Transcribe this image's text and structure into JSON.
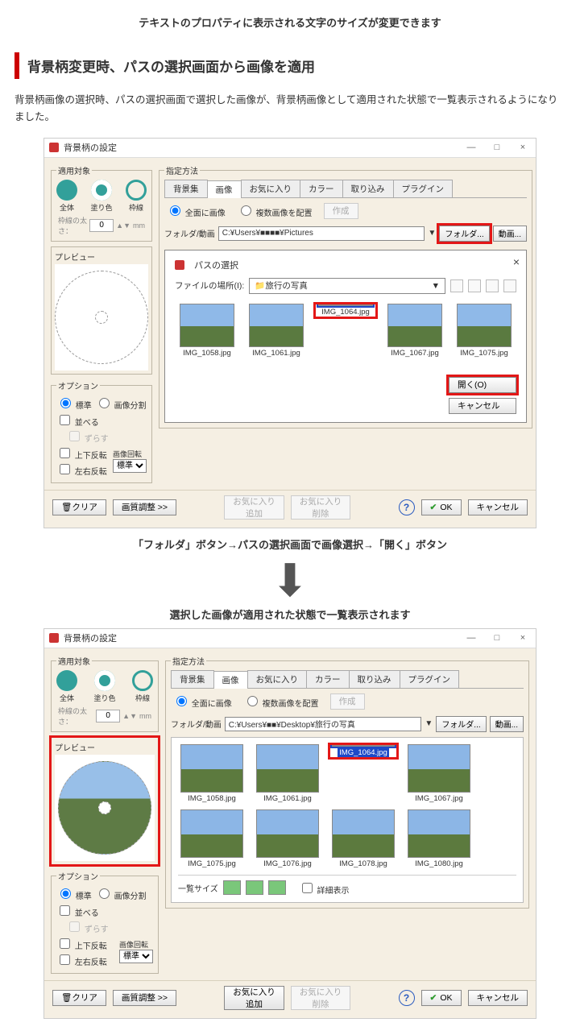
{
  "top_caption": "テキストのプロパティに表示される文字のサイズが変更できます",
  "section_title": "背景柄変更時、パスの選択画面から画像を適用",
  "body_text": "背景柄画像の選択時、パスの選択画面で選択した画像が、背景柄画像として適用された状態で一覧表示されるようになりました。",
  "mid_caption_1": "「フォルダ」ボタン→パスの選択画面で画像選択→「開く」ボタン",
  "mid_caption_2": "選択した画像が適用された状態で一覧表示されます",
  "win": {
    "title": "背景柄の設定",
    "min": "—",
    "max": "□",
    "close": "×"
  },
  "left": {
    "target_legend": "適用対象",
    "t_all": "全体",
    "t_fill": "塗り色",
    "t_border": "枠線",
    "thickness_label": "枠線の太さ：",
    "thickness_val": "0",
    "thickness_unit": "mm",
    "preview_legend": "プレビュー",
    "options_legend": "オプション",
    "opt_std": "標準",
    "opt_split": "画像分割",
    "chk_align": "並べる",
    "chk_shift": "ずらす",
    "chk_vflip": "上下反転",
    "chk_hflip": "左右反転",
    "rotate_label": "画像回転",
    "rotate_val": "標準"
  },
  "right": {
    "method_legend": "指定方法",
    "tab_bgset": "背景集",
    "tab_image": "画像",
    "tab_fav": "お気に入り",
    "tab_color": "カラー",
    "tab_import": "取り込み",
    "tab_plugin": "プラグイン",
    "mode_full": "全面に画像",
    "mode_multi": "複数画像を配置",
    "btn_make": "作成",
    "path_label": "フォルダ/動画",
    "path_val_1": "C:¥Users¥■■■■¥Pictures",
    "path_val_2": "C:¥Users¥■■¥Desktop¥旅行の写真",
    "btn_folder": "フォルダ...",
    "btn_movie": "動画...",
    "list_size_label": "一覧サイズ",
    "chk_detail": "詳細表示"
  },
  "picker": {
    "title": "パスの選択",
    "loc_label": "ファイルの場所(I):",
    "loc_val": "旅行の写真",
    "btn_open": "開く(O)",
    "btn_cancel": "キャンセル",
    "files": [
      "IMG_1058.jpg",
      "IMG_1061.jpg",
      "IMG_1064.jpg",
      "IMG_1067.jpg",
      "IMG_1075.jpg"
    ]
  },
  "gallery": {
    "row1": [
      "IMG_1058.jpg",
      "IMG_1061.jpg",
      "IMG_1064.jpg",
      "IMG_1067.jpg"
    ],
    "row2": [
      "IMG_1075.jpg",
      "IMG_1076.jpg",
      "IMG_1078.jpg",
      "IMG_1080.jpg"
    ]
  },
  "footer": {
    "clear": "クリア",
    "quality": "画質調整 >>",
    "fav_add": "お気に入り\n追加",
    "fav_del": "お気に入り\n削除",
    "ok": "OK",
    "cancel": "キャンセル"
  }
}
